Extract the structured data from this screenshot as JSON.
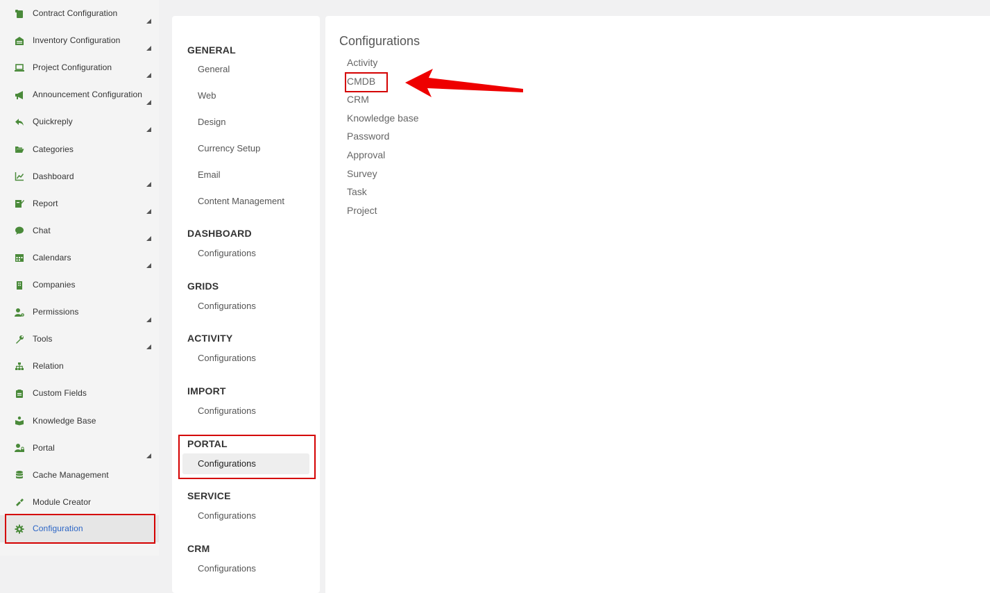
{
  "sidebar": {
    "items": [
      {
        "label": "Contract Configuration",
        "icon": "scroll-icon",
        "caret": true
      },
      {
        "label": "Inventory Configuration",
        "icon": "warehouse-icon",
        "caret": true
      },
      {
        "label": "Project Configuration",
        "icon": "laptop-icon",
        "caret": true
      },
      {
        "label": "Announcement Configuration",
        "icon": "megaphone-icon",
        "caret": true
      },
      {
        "label": "Quickreply",
        "icon": "reply-icon",
        "caret": true
      },
      {
        "label": "Categories",
        "icon": "folder-open-icon",
        "caret": false
      },
      {
        "label": "Dashboard",
        "icon": "line-chart-icon",
        "caret": true
      },
      {
        "label": "Report",
        "icon": "report-icon",
        "caret": true
      },
      {
        "label": "Chat",
        "icon": "chat-bubble-icon",
        "caret": true
      },
      {
        "label": "Calendars",
        "icon": "calendar-icon",
        "caret": true
      },
      {
        "label": "Companies",
        "icon": "building-icon",
        "caret": false
      },
      {
        "label": "Permissions",
        "icon": "user-gear-icon",
        "caret": true
      },
      {
        "label": "Tools",
        "icon": "wrench-icon",
        "caret": true
      },
      {
        "label": "Relation",
        "icon": "sitemap-icon",
        "caret": false
      },
      {
        "label": "Custom Fields",
        "icon": "clipboard-icon",
        "caret": false
      },
      {
        "label": "Knowledge Base",
        "icon": "book-reader-icon",
        "caret": false
      },
      {
        "label": "Portal",
        "icon": "user-lock-icon",
        "caret": true
      },
      {
        "label": "Cache Management",
        "icon": "database-icon",
        "caret": false
      },
      {
        "label": "Module Creator",
        "icon": "tool-icon",
        "caret": false
      },
      {
        "label": "Configuration",
        "icon": "gear-icon",
        "caret": false,
        "active": true
      }
    ]
  },
  "middle": {
    "sections": [
      {
        "title": "GENERAL",
        "links": [
          "General",
          "Web",
          "Design",
          "Currency Setup",
          "Email",
          "Content Management"
        ]
      },
      {
        "title": "DASHBOARD",
        "links": [
          "Configurations"
        ]
      },
      {
        "title": "GRIDS",
        "links": [
          "Configurations"
        ]
      },
      {
        "title": "ACTIVITY",
        "links": [
          "Configurations"
        ]
      },
      {
        "title": "IMPORT",
        "links": [
          "Configurations"
        ]
      },
      {
        "title": "PORTAL",
        "links": [
          "Configurations"
        ],
        "selected": true
      },
      {
        "title": "SERVICE",
        "links": [
          "Configurations"
        ]
      },
      {
        "title": "CRM",
        "links": [
          "Configurations"
        ]
      }
    ]
  },
  "right": {
    "title": "Configurations",
    "links": [
      "Activity",
      "CMDB",
      "CRM",
      "Knowledge base",
      "Password",
      "Approval",
      "Survey",
      "Task",
      "Project"
    ]
  },
  "colors": {
    "icon_green": "#4a8a3a",
    "highlight_red": "#d40000",
    "active_link_blue": "#2a64c5"
  }
}
